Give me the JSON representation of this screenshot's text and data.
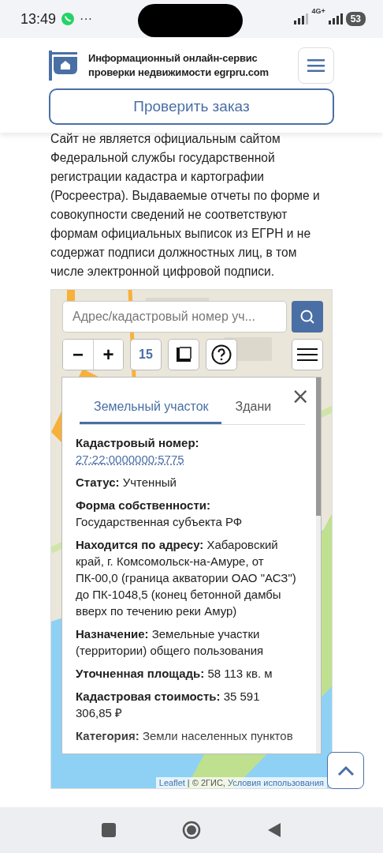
{
  "status_bar": {
    "time": "13:49",
    "more": "···",
    "network": "4G+",
    "battery": "53"
  },
  "header": {
    "title": "Информационный онлайн-сервис проверки недвижимости egrpru.com",
    "check_button": "Проверить заказ"
  },
  "disclaimer": "Сайт не является официальным сайтом Федеральной службы государственной регистрации кадастра и картографии (Росреестра). Выдаваемые отчеты по форме и совокупности сведений не соответствуют формам официальных выписок из ЕГРН и не содержат подписи должностных лиц, в том числе электронной цифровой подписи.",
  "map": {
    "search": {
      "placeholder": "Адрес/кадастровый номер уч..."
    },
    "zoom_out": "−",
    "zoom_in": "+",
    "zoom_level": "15",
    "popup": {
      "tabs": [
        {
          "label": "Земельный участок",
          "selected": true
        },
        {
          "label": "Здани",
          "selected": false
        }
      ],
      "close": "×",
      "fields": [
        {
          "kind": "link",
          "label": "Кадастровый номер:",
          "value": "27:22:0000000:5775"
        },
        {
          "kind": "text",
          "label": "Статус:",
          "value": "Учтенный"
        },
        {
          "kind": "text",
          "label": "Форма собственности:",
          "value": "Государственная субъекта РФ"
        },
        {
          "kind": "text",
          "label": "Находится по адресу:",
          "value": "Хабаровский край, г. Комсомольск-на-Амуре, от ПК-00,0 (граница акватории ОАО \"АСЗ\") до ПК-1048,5 (конец бетонной дамбы вверх по течению реки Амур)"
        },
        {
          "kind": "text",
          "label": "Назначение:",
          "value": "Земельные участки (территории) общего пользования"
        },
        {
          "kind": "text",
          "label": "Уточненная площадь:",
          "value": "58 113 кв. м"
        },
        {
          "kind": "text",
          "label": "Кадастровая стоимость:",
          "value": "35 591 306,85 ₽"
        },
        {
          "kind": "text",
          "label": "Категория:",
          "value": "Земли населенных пунктов"
        }
      ]
    },
    "attribution": [
      {
        "kind": "link",
        "text": "Leaflet"
      },
      {
        "kind": "text",
        "text": "| © 2ГИС,"
      },
      {
        "kind": "link",
        "text": "Условия использования"
      }
    ]
  }
}
